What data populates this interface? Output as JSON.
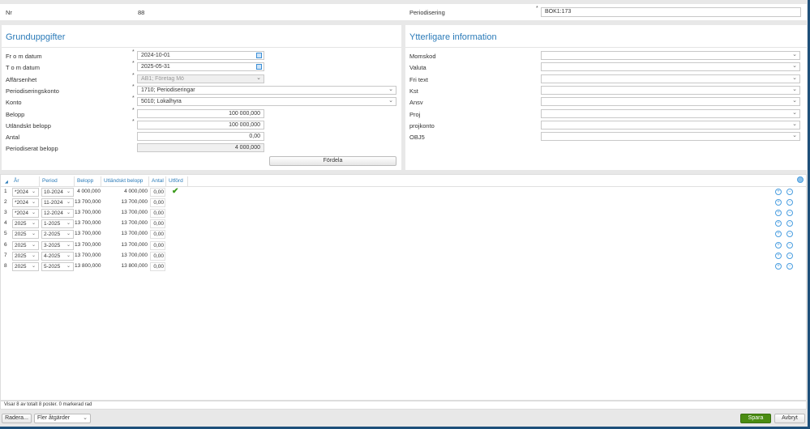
{
  "top": {
    "nr_label": "Nr",
    "nr_value": "88",
    "periodisering_label": "Periodisering",
    "periodisering_value": "BOK1:173"
  },
  "basic": {
    "title": "Grunduppgifter",
    "from_label": "Fr o m datum",
    "from_value": "2024-10-01",
    "tom_label": "T o m datum",
    "tom_value": "2025-05-31",
    "unit_label": "Affärsenhet",
    "unit_value": "AB1; Företag Mö",
    "pkonto_label": "Periodiseringskonto",
    "pkonto_value": "1710; Periodiseringar",
    "konto_label": "Konto",
    "konto_value": "5010; Lokalhyra",
    "belopp_label": "Belopp",
    "belopp_value": "100 000,000",
    "ubelopp_label": "Utländskt belopp",
    "ubelopp_value": "100 000,000",
    "antal_label": "Antal",
    "antal_value": "0,00",
    "pbelopp_label": "Periodiserat belopp",
    "pbelopp_value": "4 000,000",
    "distribute_button": "Fördela"
  },
  "extra": {
    "title": "Ytterligare information",
    "fields": [
      "Momskod",
      "Valuta",
      "Fri text",
      "Kst",
      "Ansv",
      "Proj",
      "projkonto",
      "OBJ5"
    ]
  },
  "grid": {
    "headers": [
      "År",
      "Period",
      "Belopp",
      "Utländskt belopp",
      "Antal",
      "Utförd"
    ],
    "rows": [
      {
        "n": "1",
        "year": "*2024",
        "period": "10-2024",
        "belopp": "4 000,000",
        "ubelopp": "4 000,000",
        "antal": "0,00",
        "done": true
      },
      {
        "n": "2",
        "year": "*2024",
        "period": "11-2024",
        "belopp": "13 700,000",
        "ubelopp": "13 700,000",
        "antal": "0,00",
        "done": false
      },
      {
        "n": "3",
        "year": "*2024",
        "period": "12-2024",
        "belopp": "13 700,000",
        "ubelopp": "13 700,000",
        "antal": "0,00",
        "done": false
      },
      {
        "n": "4",
        "year": "2025",
        "period": "1-2025",
        "belopp": "13 700,000",
        "ubelopp": "13 700,000",
        "antal": "0,00",
        "done": false
      },
      {
        "n": "5",
        "year": "2025",
        "period": "2-2025",
        "belopp": "13 700,000",
        "ubelopp": "13 700,000",
        "antal": "0,00",
        "done": false
      },
      {
        "n": "6",
        "year": "2025",
        "period": "3-2025",
        "belopp": "13 700,000",
        "ubelopp": "13 700,000",
        "antal": "0,00",
        "done": false
      },
      {
        "n": "7",
        "year": "2025",
        "period": "4-2025",
        "belopp": "13 700,000",
        "ubelopp": "13 700,000",
        "antal": "0,00",
        "done": false
      },
      {
        "n": "8",
        "year": "2025",
        "period": "5-2025",
        "belopp": "13 800,000",
        "ubelopp": "13 800,000",
        "antal": "0,00",
        "done": false
      }
    ]
  },
  "status": "Visar 8 av totalt 8 poster. 0 markerad rad",
  "footer": {
    "delete": "Radera...",
    "more": "Fler åtgärder",
    "save": "Spara",
    "cancel": "Avbryt"
  },
  "colors": {
    "accent": "#2a7ab8",
    "save": "#4a8c12",
    "check": "#3a9a1a"
  }
}
